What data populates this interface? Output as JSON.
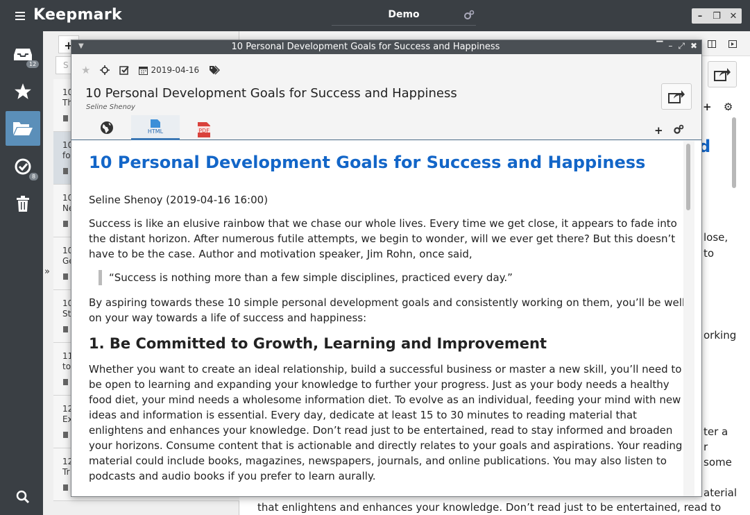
{
  "app": {
    "name": "Keepmark",
    "workspace": "Demo"
  },
  "window_controls": [
    "–",
    "❐",
    "✕"
  ],
  "rail": {
    "inbox_count": "12",
    "tasks_count": "8"
  },
  "list": {
    "search_placeholder": "S",
    "expand_glyph": "»",
    "items": [
      {
        "title": "10\nTh"
      },
      {
        "title": "10\nfo"
      },
      {
        "title": "10\nNe"
      },
      {
        "title": "10\nGe"
      },
      {
        "title": "10\nSt"
      },
      {
        "title": "11\nto"
      },
      {
        "title": "12\nEx"
      },
      {
        "title": "12\nTr"
      }
    ]
  },
  "background_panel": {
    "fragments": [
      "d",
      "lose,",
      "to",
      "orking",
      "ter a",
      "r",
      "some",
      "aterial",
      "that enlightens and enhances your knowledge. Don’t read just to be entertained, read to"
    ]
  },
  "reader": {
    "window_title": "10 Personal Development Goals for Success and Happiness",
    "date": "2019-04-16",
    "title": "10 Personal Development Goals for Success and Happiness",
    "author": "Seline Shenoy",
    "tabs": [
      {
        "name": "web",
        "label": ""
      },
      {
        "name": "html",
        "label": "HTML"
      },
      {
        "name": "pdf",
        "label": "PDF"
      }
    ]
  },
  "article": {
    "heading": "10 Personal Development Goals for Success and Happiness",
    "byline": "Seline Shenoy (2019-04-16 16:00)",
    "p1": "Success is like an elusive rainbow that we chase our whole lives. Every time we get close, it appears to fade into the distant horizon. After numerous futile attempts, we begin to wonder, will we ever get there? But this doesn’t have to be the case. Author and motivation speaker, Jim Rohn, once said,",
    "quote": "“Success is nothing more than a few simple disciplines, practiced every day.”",
    "p2": "By aspiring towards these 10 simple personal development goals and consistently working on them, you’ll be well on your way towards a life of success and happiness:",
    "h2": "1. Be Committed to Growth, Learning and Improvement",
    "p3": "Whether you want to create an ideal relationship, build a successful business or master a new skill, you’ll need to be open to learning and expanding your knowledge to further your progress. Just as your body needs a healthy food diet, your mind needs a wholesome information diet. To evolve as an individual, feeding your mind with new ideas and information is essential. Every day, dedicate at least 15 to 30 minutes to reading material that enlightens and enhances your knowledge. Don’t read just to be entertained, read to stay informed and broaden your horizons. Consume content that is actionable and directly relates to your goals and aspirations. Your reading material could include books, magazines, newspapers, journals, and online publications. You may also listen to podcasts and audio books if you prefer to learn aurally."
  },
  "colors": {
    "dark": "#3a3f44",
    "accent": "#5b8fb9",
    "link": "#1366c8"
  }
}
